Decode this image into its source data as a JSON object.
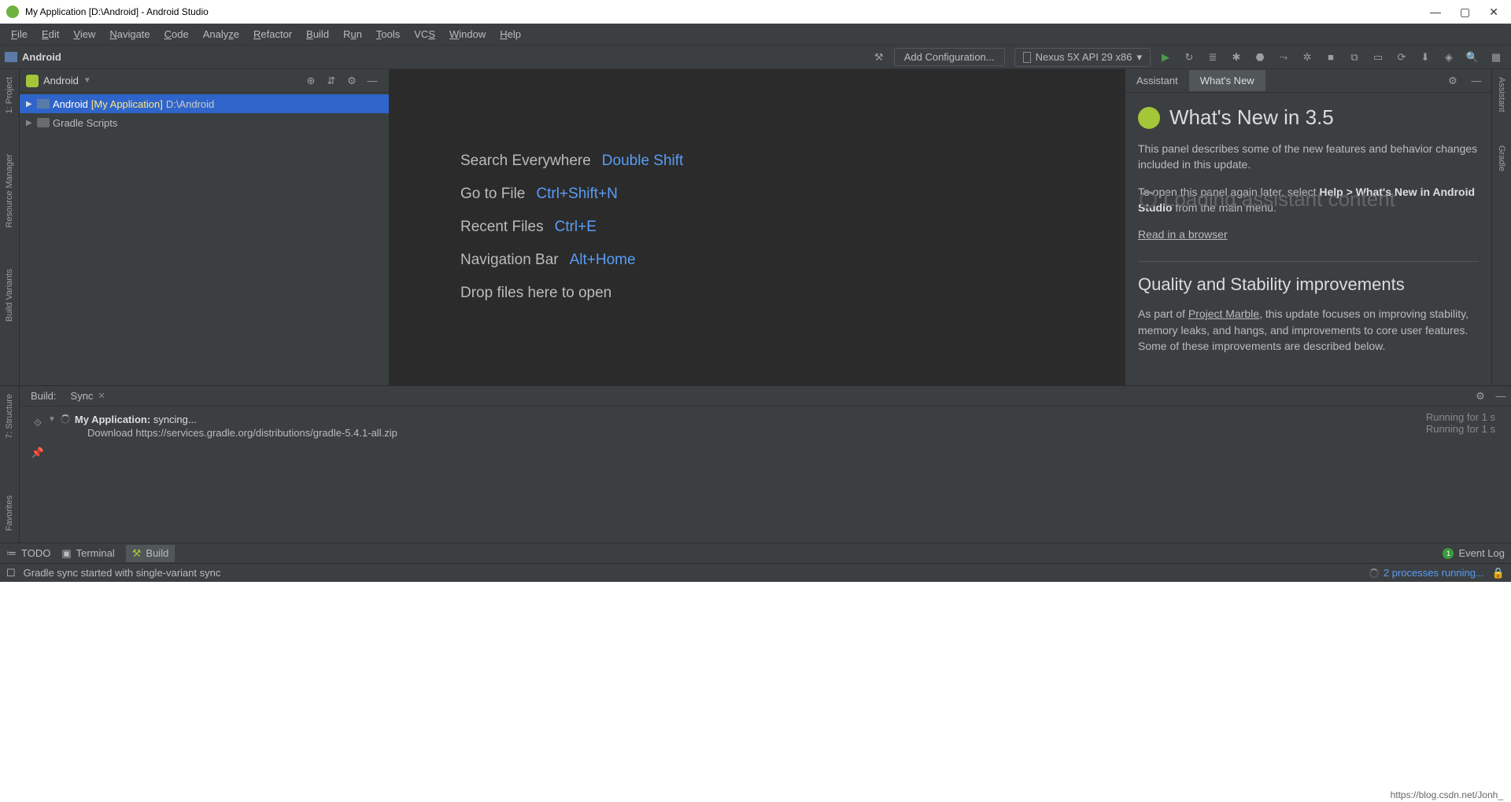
{
  "titlebar": {
    "title": "My Application [D:\\Android] - Android Studio"
  },
  "menu": {
    "items": [
      "File",
      "Edit",
      "View",
      "Navigate",
      "Code",
      "Analyze",
      "Refactor",
      "Build",
      "Run",
      "Tools",
      "VCS",
      "Window",
      "Help"
    ]
  },
  "toolbar": {
    "breadcrumb": "Android",
    "addConfig": "Add Configuration...",
    "device": "Nexus 5X API 29 x86"
  },
  "leftTabs": {
    "project": "1: Project",
    "resmgr": "Resource Manager",
    "variants": "Build Variants"
  },
  "rightTabs": {
    "assistant": "Assistant",
    "gradle": "Gradle"
  },
  "projectPanel": {
    "viewLabel": "Android",
    "items": [
      {
        "name": "Android",
        "bracket": "[My Application]",
        "path": "D:\\Android"
      },
      {
        "name": "Gradle Scripts"
      }
    ]
  },
  "editor": {
    "rows": [
      {
        "label": "Search Everywhere",
        "shortcut": "Double Shift"
      },
      {
        "label": "Go to File",
        "shortcut": "Ctrl+Shift+N"
      },
      {
        "label": "Recent Files",
        "shortcut": "Ctrl+E"
      },
      {
        "label": "Navigation Bar",
        "shortcut": "Alt+Home"
      },
      {
        "label": "Drop files here to open",
        "shortcut": ""
      }
    ]
  },
  "assistant": {
    "tabs": {
      "assistant": "Assistant",
      "whatsnew": "What's New"
    },
    "heading": "What's New in 3.5",
    "para1": "This panel describes some of the new features and behavior changes included in this update.",
    "para2a": "To open this panel again later, select ",
    "para2b": "Help > What's New in Android Studio",
    "para2c": " from the main menu.",
    "readLink": "Read in a browser",
    "loading": "Loading assistant content",
    "section2h": "Quality and Stability improvements",
    "section2p_a": "As part of ",
    "section2p_link": "Project Marble",
    "section2p_b": ", this update focuses on improving stability, memory leaks, and hangs, and improvements to core user features. Some of these improvements are described below."
  },
  "build": {
    "label": "Build:",
    "tab": "Sync",
    "row1a": "My Application:",
    "row1b": " syncing...",
    "row2": "Download https://services.gradle.org/distributions/gradle-5.4.1-all.zip",
    "time1": "Running for 1 s",
    "time2": "Running for 1 s"
  },
  "bottomTabs": {
    "structure": "7: Structure",
    "favorites": "Favorites",
    "todo": "TODO",
    "terminal": "Terminal",
    "build": "Build",
    "eventlog": "Event Log",
    "eventCount": "1"
  },
  "status": {
    "msg": "Gradle sync started with single-variant sync",
    "link": "2 processes running..."
  },
  "footer": {
    "url": "https://blog.csdn.net/Jonh_"
  }
}
